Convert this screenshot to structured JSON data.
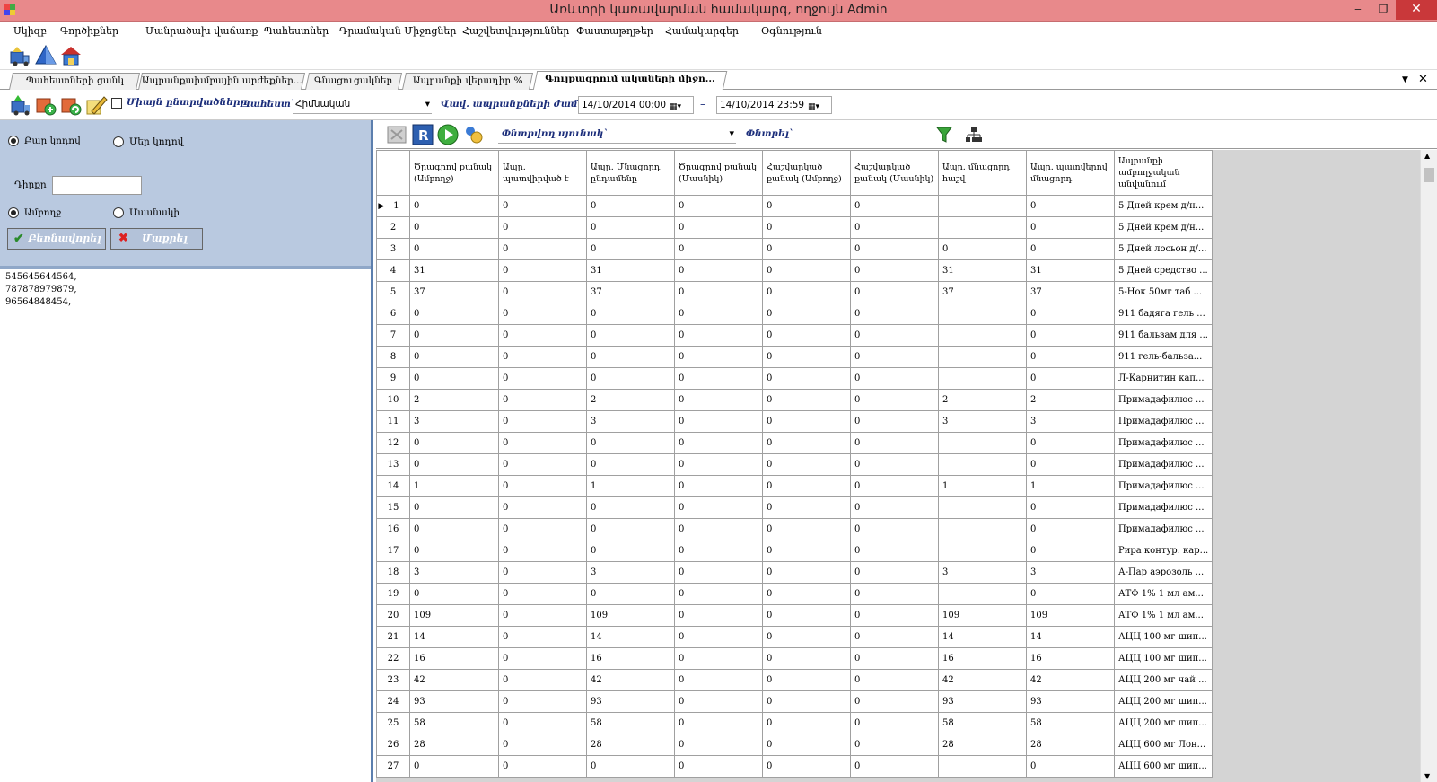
{
  "window": {
    "title": "Առևտրի կառավարման համակարգ, ողջույն Admin",
    "min_icon": "minimize-glyph",
    "max_icon": "restore-glyph",
    "close_icon": "close-glyph",
    "min_glyph": "‒",
    "max_glyph": "❐",
    "close_glyph": "✕"
  },
  "menu": [
    "Սկիզբ",
    "Գործիքներ",
    "Մանրածախ վաճառք",
    "Պահեստներ",
    "Դրամական Միջոցներ",
    "Հաշվետվություններ",
    "Փաստաթղթեր",
    "Համակարգեր",
    "Օգնություն"
  ],
  "tabs": [
    "Պահեստների ցանկ",
    "Ապրանքախմբային արժեքներ...",
    "Գնացուցակներ",
    "Ապրանքի վերադիր %",
    "Գույքագրում ակաների միջո..."
  ],
  "tabstrip": {
    "dropdown_glyph": "▼",
    "close_glyph": "✕"
  },
  "filters": {
    "only_selected_label": "Միայն ընտրվածները",
    "warehouse_label": "Պահեստ`",
    "warehouse_value": "Հիմնական",
    "period_label": "Վավ. ապրանքների ժամ.`",
    "date_from": "14/10/2014 00:00",
    "date_dash": "–",
    "date_to": "14/10/2014 23:59",
    "cal_glyph": "▦▾",
    "combo_glyph": "▾"
  },
  "left": {
    "radio1": "Բար կոդով",
    "radio2": "Մեր կոդով",
    "field_label": "Դիրքը",
    "radio3": "Ամբողջ",
    "radio4": "Մասնակի",
    "confirm_button": "Բեռնավորել",
    "clear_button": "Մաքրել",
    "codes": [
      "545645644564,",
      "787878979879,",
      "96564848454,"
    ]
  },
  "gridtoolbar": {
    "search_column_label": "Փնտրվող սյունակ`",
    "search_label": "Փնտրել`",
    "combo_glyph": "▾"
  },
  "columns": [
    "Ծրագրով քանակ (Ամբողջ)",
    "Ապր. պատվիրված է",
    "Ապր. Մնացորդ ընդամենը",
    "Ծրագրով քանակ (Մասնիկ)",
    "Հաշվարկած քանակ (Ամբողջ)",
    "Հաշվարկած քանակ (Մասնիկ)",
    "Ապր. մնացորդ հաշվ",
    "Ապր. պատվերով մնացորդ",
    "Ապրանքի ամբողջական անվանում"
  ],
  "rows": [
    [
      "1",
      "0",
      "0",
      "0",
      "0",
      "0",
      "0",
      "",
      "0",
      "5 Дней крем д/н..."
    ],
    [
      "2",
      "0",
      "0",
      "0",
      "0",
      "0",
      "0",
      "",
      "0",
      "5 Дней крем д/н..."
    ],
    [
      "3",
      "0",
      "0",
      "0",
      "0",
      "0",
      "0",
      "0",
      "0",
      "5 Дней лосьон д/..."
    ],
    [
      "4",
      "31",
      "0",
      "31",
      "0",
      "0",
      "0",
      "31",
      "31",
      "5 Дней средство ..."
    ],
    [
      "5",
      "37",
      "0",
      "37",
      "0",
      "0",
      "0",
      "37",
      "37",
      "5-Нок 50мг таб ..."
    ],
    [
      "6",
      "0",
      "0",
      "0",
      "0",
      "0",
      "0",
      "",
      "0",
      "911 бадяга гель ..."
    ],
    [
      "7",
      "0",
      "0",
      "0",
      "0",
      "0",
      "0",
      "",
      "0",
      "911 бальзам для ..."
    ],
    [
      "8",
      "0",
      "0",
      "0",
      "0",
      "0",
      "0",
      "",
      "0",
      "911 гель-бальза..."
    ],
    [
      "9",
      "0",
      "0",
      "0",
      "0",
      "0",
      "0",
      "",
      "0",
      "Л-Карнитин кап..."
    ],
    [
      "10",
      "2",
      "0",
      "2",
      "0",
      "0",
      "0",
      "2",
      "2",
      "Примадафилюс ..."
    ],
    [
      "11",
      "3",
      "0",
      "3",
      "0",
      "0",
      "0",
      "3",
      "3",
      "Примадафилюс ..."
    ],
    [
      "12",
      "0",
      "0",
      "0",
      "0",
      "0",
      "0",
      "",
      "0",
      "Примадафилюс ..."
    ],
    [
      "13",
      "0",
      "0",
      "0",
      "0",
      "0",
      "0",
      "",
      "0",
      "Примадафилюс ..."
    ],
    [
      "14",
      "1",
      "0",
      "1",
      "0",
      "0",
      "0",
      "1",
      "1",
      "Примадафилюс ..."
    ],
    [
      "15",
      "0",
      "0",
      "0",
      "0",
      "0",
      "0",
      "",
      "0",
      "Примадафилюс ..."
    ],
    [
      "16",
      "0",
      "0",
      "0",
      "0",
      "0",
      "0",
      "",
      "0",
      "Примадафилюс ..."
    ],
    [
      "17",
      "0",
      "0",
      "0",
      "0",
      "0",
      "0",
      "",
      "0",
      "Рира контур. кар..."
    ],
    [
      "18",
      "3",
      "0",
      "3",
      "0",
      "0",
      "0",
      "3",
      "3",
      "А-Пар аэрозоль ..."
    ],
    [
      "19",
      "0",
      "0",
      "0",
      "0",
      "0",
      "0",
      "",
      "0",
      "АТФ 1% 1 мл ам..."
    ],
    [
      "20",
      "109",
      "0",
      "109",
      "0",
      "0",
      "0",
      "109",
      "109",
      "АТФ 1% 1 мл ам..."
    ],
    [
      "21",
      "14",
      "0",
      "14",
      "0",
      "0",
      "0",
      "14",
      "14",
      "АЦЦ 100 мг шип..."
    ],
    [
      "22",
      "16",
      "0",
      "16",
      "0",
      "0",
      "0",
      "16",
      "16",
      "АЦЦ 100 мг шип..."
    ],
    [
      "23",
      "42",
      "0",
      "42",
      "0",
      "0",
      "0",
      "42",
      "42",
      "АЦЦ 200 мг чай ..."
    ],
    [
      "24",
      "93",
      "0",
      "93",
      "0",
      "0",
      "0",
      "93",
      "93",
      "АЦЦ 200 мг шип..."
    ],
    [
      "25",
      "58",
      "0",
      "58",
      "0",
      "0",
      "0",
      "58",
      "58",
      "АЦЦ 200 мг шип..."
    ],
    [
      "26",
      "28",
      "0",
      "28",
      "0",
      "0",
      "0",
      "28",
      "28",
      "АЦЦ 600 мг Лон..."
    ],
    [
      "27",
      "0",
      "0",
      "0",
      "0",
      "0",
      "0",
      "",
      "0",
      "АЦЦ 600 мг шип..."
    ]
  ],
  "current_row_glyph": "▶",
  "colors": {
    "title_bar": "#e8898b",
    "panel": "#b9c9e0",
    "accent": "#1b2d7a"
  }
}
